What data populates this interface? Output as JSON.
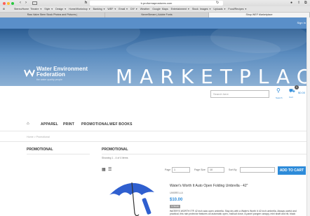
{
  "browser": {
    "address": "b.proformaprostores.com",
    "bookmarks": [
      "Stereo/Home Theatre ▾",
      "Style ▾",
      "Design ▾",
      "Home/Workshop ▾",
      "Banking ▾",
      "WEF ▾",
      "Email ▾",
      "DIY ▾",
      "Weather",
      "Google Maps",
      "Entertainment ▾",
      "Stock Images ▾",
      "Uploads ▾",
      "Food/Recipes ▾"
    ],
    "tabs": [
      {
        "label": "Raw Valve Stem Stock Photos and Pictures |",
        "active": false
      },
      {
        "label": "NeverStream | Adobe Fonts",
        "active": false
      },
      {
        "label": "Shop WEF Marketplace",
        "active": true
      }
    ]
  },
  "site": {
    "sign_in": "Sign In",
    "logo_line1": "Water Environment",
    "logo_line2": "Federation",
    "logo_tagline": "the water quality people",
    "banner_title": "MARKETPLACE",
    "search_placeholder": "Search here",
    "search_label": "Search",
    "cart_label": "Cart",
    "cart_total": "$0.00",
    "cart_count": "0",
    "nav": [
      "APPAREL",
      "PRINT",
      "PROMOTIONAL",
      "WEF BOOKS"
    ],
    "breadcrumb": "Home > Promotional",
    "sidebar_title": "PROMOTIONAL",
    "main_title": "PROMOTIONAL",
    "showing": "Showing 1 - 4 of 4 items",
    "page_label": "Page",
    "page_value": "1",
    "page_size_label": "Page Size",
    "page_size_value": "10",
    "sort_label": "Sort By",
    "sort_value": "",
    "add_to_cart": "ADD TO CART",
    "product": {
      "title": "Water's Worth It Auto Open Folding Umbrella - 42\"",
      "code": "UMBRELLA",
      "price": "$10.00",
      "stock": "In Stock",
      "description": "WATER'S WORTH IT® 42 inch auto open umbrella. Stay dry with a Water's Worth It 42 inch umbrella. Always useful and practical, this rain protector features an automatic open, manual close, 8-panel pongee canopy, mini shaft and rib, black polypropylene plastic handle, 5.5\" polyester wrist strap and a 42\" arc coverage."
    }
  },
  "colors": {
    "accent": "#2d8bd9",
    "topbar": "#5a8fc9"
  }
}
